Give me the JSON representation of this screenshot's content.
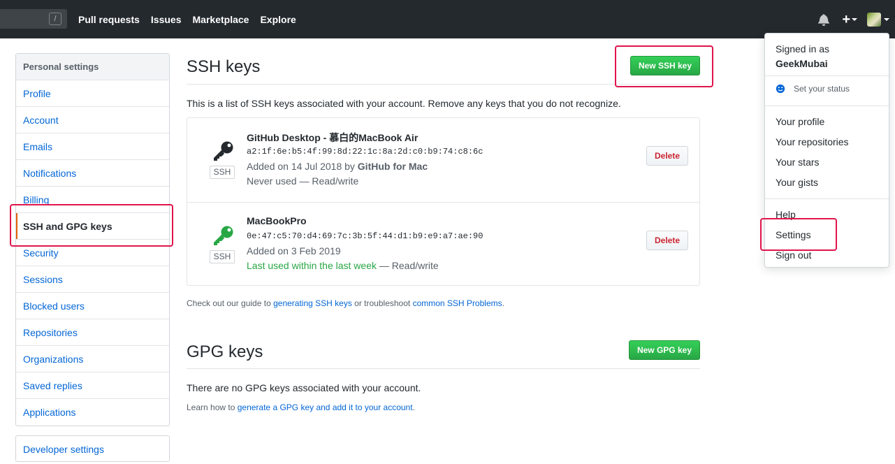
{
  "header": {
    "search_slash": "/",
    "nav": [
      "Pull requests",
      "Issues",
      "Marketplace",
      "Explore"
    ],
    "plus": "+"
  },
  "sidebar": {
    "heading": "Personal settings",
    "items": [
      {
        "label": "Profile"
      },
      {
        "label": "Account"
      },
      {
        "label": "Emails"
      },
      {
        "label": "Notifications"
      },
      {
        "label": "Billing"
      },
      {
        "label": "SSH and GPG keys",
        "selected": true
      },
      {
        "label": "Security"
      },
      {
        "label": "Sessions"
      },
      {
        "label": "Blocked users"
      },
      {
        "label": "Repositories"
      },
      {
        "label": "Organizations"
      },
      {
        "label": "Saved replies"
      },
      {
        "label": "Applications"
      }
    ],
    "developer": "Developer settings"
  },
  "ssh": {
    "title": "SSH keys",
    "new_button": "New SSH key",
    "description": "This is a list of SSH keys associated with your account. Remove any keys that you do not recognize.",
    "keys": [
      {
        "title": "GitHub Desktop - 慕白的MacBook Air",
        "fingerprint": "a2:1f:6e:b5:4f:99:8d:22:1c:8a:2d:c0:b9:74:c8:6c",
        "added_prefix": "Added on 14 Jul 2018 by",
        "added_by": "GitHub for Mac",
        "used_status": "Never used",
        "access": "— Read/write",
        "label": "SSH",
        "delete": "Delete",
        "icon_color": "#24292e"
      },
      {
        "title": "MacBookPro",
        "fingerprint": "0e:47:c5:70:d4:69:7c:3b:5f:44:d1:b9:e9:a7:ae:90",
        "added_prefix": "Added on 3 Feb 2019",
        "added_by": "",
        "used_status": "Last used within the last week",
        "access": "— Read/write",
        "label": "SSH",
        "delete": "Delete",
        "icon_color": "#28a745"
      }
    ],
    "help_prefix": "Check out our guide to",
    "help_link1": "generating SSH keys",
    "help_mid": "or troubleshoot",
    "help_link2": "common SSH Problems",
    "help_suffix": "."
  },
  "gpg": {
    "title": "GPG keys",
    "new_button": "New GPG key",
    "description": "There are no GPG keys associated with your account.",
    "help_prefix": "Learn how to",
    "help_link": "generate a GPG key and add it to your account",
    "help_suffix": "."
  },
  "dropdown": {
    "signed_in_as": "Signed in as",
    "username": "GeekMubai",
    "set_status": "Set your status",
    "items1": [
      "Your profile",
      "Your repositories",
      "Your stars",
      "Your gists"
    ],
    "items2": [
      "Help",
      "Settings",
      "Sign out"
    ]
  },
  "colors": {
    "header_bg": "#24292e",
    "link": "#0366d6",
    "green": "#28a745",
    "highlight": "#e0154b"
  }
}
